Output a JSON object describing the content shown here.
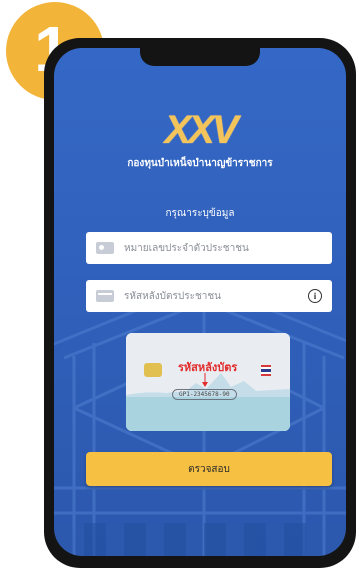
{
  "step": {
    "number": "1"
  },
  "logo": {
    "mark": "XXV",
    "subtitle": "กองทุนบำเหน็จบำนาญข้าราชการ"
  },
  "form": {
    "prompt": "กรุณาระบุข้อมูล",
    "id_field": {
      "placeholder": "หมายเลขประจำตัวประชาชน",
      "value": "",
      "icon": "id-card-icon"
    },
    "laser_field": {
      "placeholder": "รหัสหลังบัตรประชาชน",
      "value": "",
      "icon": "card-icon",
      "info_icon": "info-icon"
    }
  },
  "card_example": {
    "label": "รหัสหลังบัตร",
    "number": "GP1-2345678-90"
  },
  "actions": {
    "check_label": "ตรวจสอบ"
  },
  "colors": {
    "accent": "#f6c142",
    "background": "#3568c6",
    "badge": "#f2b53a",
    "card_label": "#e22b2b"
  }
}
